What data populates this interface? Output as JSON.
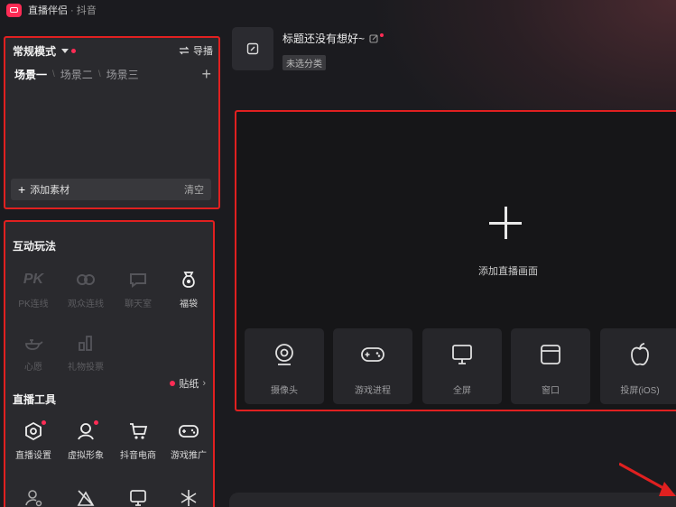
{
  "app": {
    "title": "直播伴侣",
    "subtitle": "· 抖音"
  },
  "scene": {
    "mode_label": "常规模式",
    "guide_label": "导播",
    "tabs": [
      {
        "label": "场景一",
        "active": true
      },
      {
        "label": "场景二",
        "active": false
      },
      {
        "label": "场景三",
        "active": false
      }
    ],
    "add_material": "添加素材",
    "clear": "清空"
  },
  "interactive": {
    "title": "互动玩法",
    "items": [
      {
        "label": "PK连线",
        "icon": "pk-icon",
        "enabled": false
      },
      {
        "label": "观众连线",
        "icon": "link-icon",
        "enabled": false
      },
      {
        "label": "聊天室",
        "icon": "chatroom-icon",
        "enabled": false
      },
      {
        "label": "福袋",
        "icon": "lucky-bag-icon",
        "enabled": true
      },
      {
        "label": "心愿",
        "icon": "wish-lamp-icon",
        "enabled": false
      },
      {
        "label": "礼物投票",
        "icon": "gift-vote-icon",
        "enabled": false
      }
    ]
  },
  "tools": {
    "title": "直播工具",
    "sticker_label": "贴纸",
    "items": [
      {
        "label": "直播设置",
        "icon": "settings-icon",
        "dot": true
      },
      {
        "label": "虚拟形象",
        "icon": "avatar-icon",
        "dot": true
      },
      {
        "label": "抖音电商",
        "icon": "cart-icon",
        "dot": false
      },
      {
        "label": "游戏推广",
        "icon": "gamepad-icon",
        "dot": false
      }
    ]
  },
  "header": {
    "stream_title": "标题还没有想好~",
    "category": "未选分类"
  },
  "preview": {
    "add_label": "添加直播画面",
    "sources": [
      {
        "label": "摄像头",
        "icon": "camera-icon"
      },
      {
        "label": "游戏进程",
        "icon": "gamepad-icon"
      },
      {
        "label": "全屏",
        "icon": "monitor-icon"
      },
      {
        "label": "窗口",
        "icon": "window-icon"
      },
      {
        "label": "投屏(iOS)",
        "icon": "apple-icon"
      }
    ]
  },
  "colors": {
    "accent": "#fe2c55",
    "highlight_border": "#e02020",
    "panel_bg": "#2a2a2e",
    "app_bg": "#1b1b1f"
  }
}
